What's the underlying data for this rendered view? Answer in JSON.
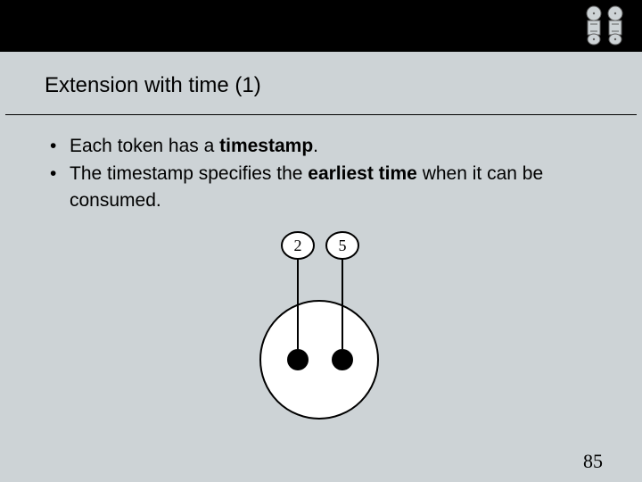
{
  "slide": {
    "title": "Extension with time (1)",
    "bullets": [
      {
        "pre": "Each token has a ",
        "bold": "timestamp",
        "post": "."
      },
      {
        "pre": "The timestamp specifies the ",
        "bold": "earliest time",
        "post": " when it can be consumed."
      }
    ],
    "page_number": "85"
  },
  "diagram": {
    "labels": {
      "left": "2",
      "right": "5"
    }
  }
}
